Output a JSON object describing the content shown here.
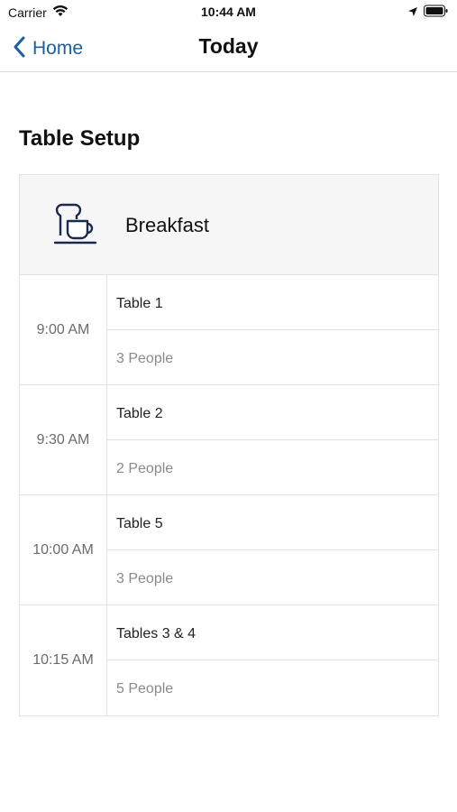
{
  "status_bar": {
    "carrier": "Carrier",
    "time": "10:44 AM"
  },
  "nav": {
    "back_label": "Home",
    "title": "Today"
  },
  "section_title": "Table Setup",
  "meal": {
    "label": "Breakfast",
    "icon": "coffee-toast-icon"
  },
  "slots": [
    {
      "time": "9:00 AM",
      "table": "Table 1",
      "people": "3 People"
    },
    {
      "time": "9:30 AM",
      "table": "Table 2",
      "people": "2 People"
    },
    {
      "time": "10:00 AM",
      "table": "Table 5",
      "people": "3 People"
    },
    {
      "time": "10:15 AM",
      "table": "Tables 3 & 4",
      "people": "5 People"
    }
  ],
  "colors": {
    "accent": "#1c5ea0",
    "header_bg": "#f6f6f6",
    "border": "#e2e2e2"
  }
}
